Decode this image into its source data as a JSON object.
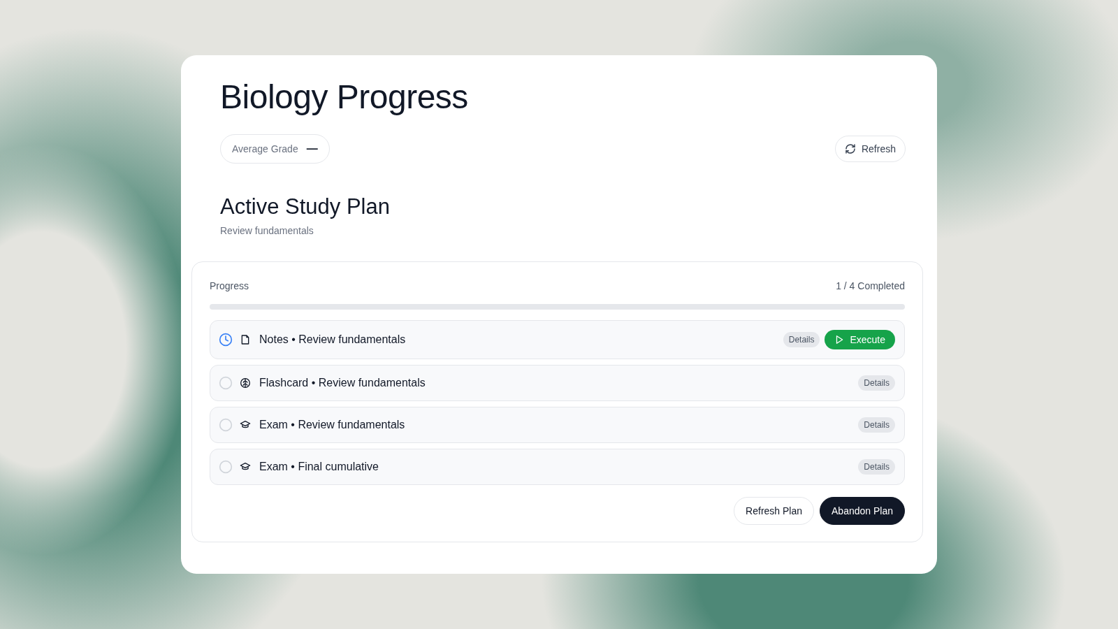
{
  "title": "Biology Progress",
  "average_grade": {
    "label": "Average Grade",
    "value": "—"
  },
  "refresh_button": "Refresh",
  "plan": {
    "title": "Active Study Plan",
    "subtitle": "Review fundamentals"
  },
  "progress": {
    "label": "Progress",
    "summary": "1 / 4 Completed"
  },
  "tasks": [
    {
      "in_progress": true,
      "kind": "notes",
      "label": "Notes • Review fundamentals",
      "details": "Details",
      "action": "Execute"
    },
    {
      "in_progress": false,
      "kind": "flashcard",
      "label": "Flashcard • Review fundamentals",
      "details": "Details"
    },
    {
      "in_progress": false,
      "kind": "exam",
      "label": "Exam • Review fundamentals",
      "details": "Details"
    },
    {
      "in_progress": false,
      "kind": "exam",
      "label": "Exam • Final cumulative",
      "details": "Details"
    }
  ],
  "buttons": [
    {
      "label": "Refresh Plan",
      "kind": "secondary"
    },
    {
      "label": "Abandon Plan",
      "kind": "primary"
    }
  ]
}
